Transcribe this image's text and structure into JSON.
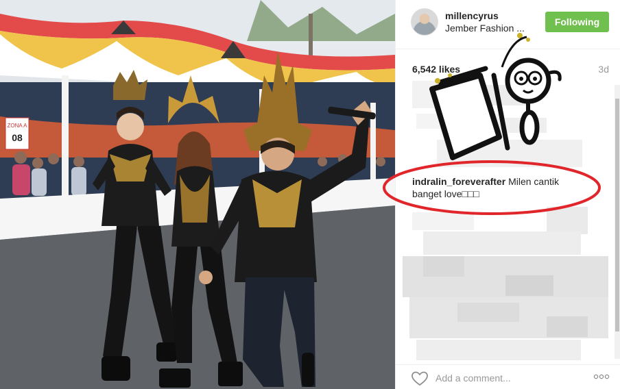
{
  "photo": {
    "alt": "Three people in carnival costumes walking on a road",
    "sign_label": "ZONA A",
    "sign_number": "08"
  },
  "post": {
    "username": "millencyrus",
    "location": "Jember Fashion ...",
    "follow_label": "Following",
    "likes": "6,542 likes",
    "time": "3d"
  },
  "comment": {
    "user": "indralin_foreverafter",
    "text": "Milen cantik banget love□□□"
  },
  "footer": {
    "comment_placeholder": "Add a comment...",
    "heart_icon": "heart-icon",
    "more_icon": "more-options-icon"
  },
  "colors": {
    "follow_green": "#70c050",
    "annotation_red": "#e0262a",
    "tent_red": "#e34a4a",
    "tent_yellow": "#f0c44a"
  }
}
